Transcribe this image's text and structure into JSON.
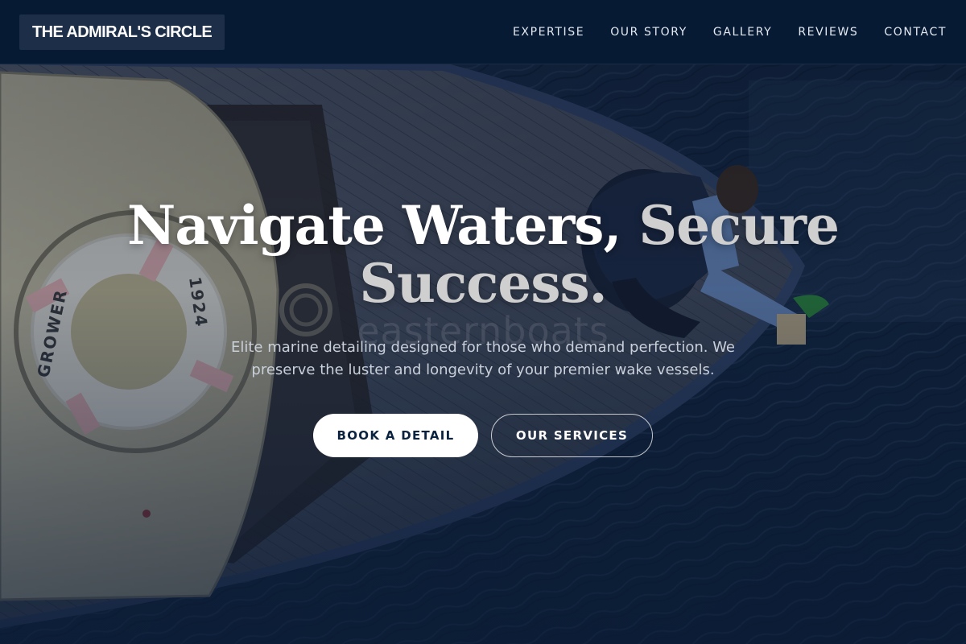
{
  "brand": {
    "name": "THE ADMIRAL'S CIRCLE",
    "navy": "#071a33",
    "logo_bg": "#1d2f48"
  },
  "nav": {
    "links": [
      {
        "label": "EXPERTISE"
      },
      {
        "label": "OUR STORY"
      },
      {
        "label": "GALLERY"
      },
      {
        "label": "REVIEWS"
      },
      {
        "label": "CONTACT"
      }
    ]
  },
  "hero": {
    "title_main": "Navigate Waters, ",
    "title_accent": "Secure Success.",
    "subtitle": "Elite marine detailing designed for those who demand perfection. We preserve the luster and longevity of your premier wake vessels.",
    "watermark": "easternboats",
    "ring_text": "GROWER",
    "ring_year": "1924",
    "primary_cta": "BOOK A DETAIL",
    "secondary_cta": "OUR SERVICES",
    "icons": {
      "background": "boat-deck-aerial-photo",
      "life-ring": "life-ring-icon"
    }
  }
}
